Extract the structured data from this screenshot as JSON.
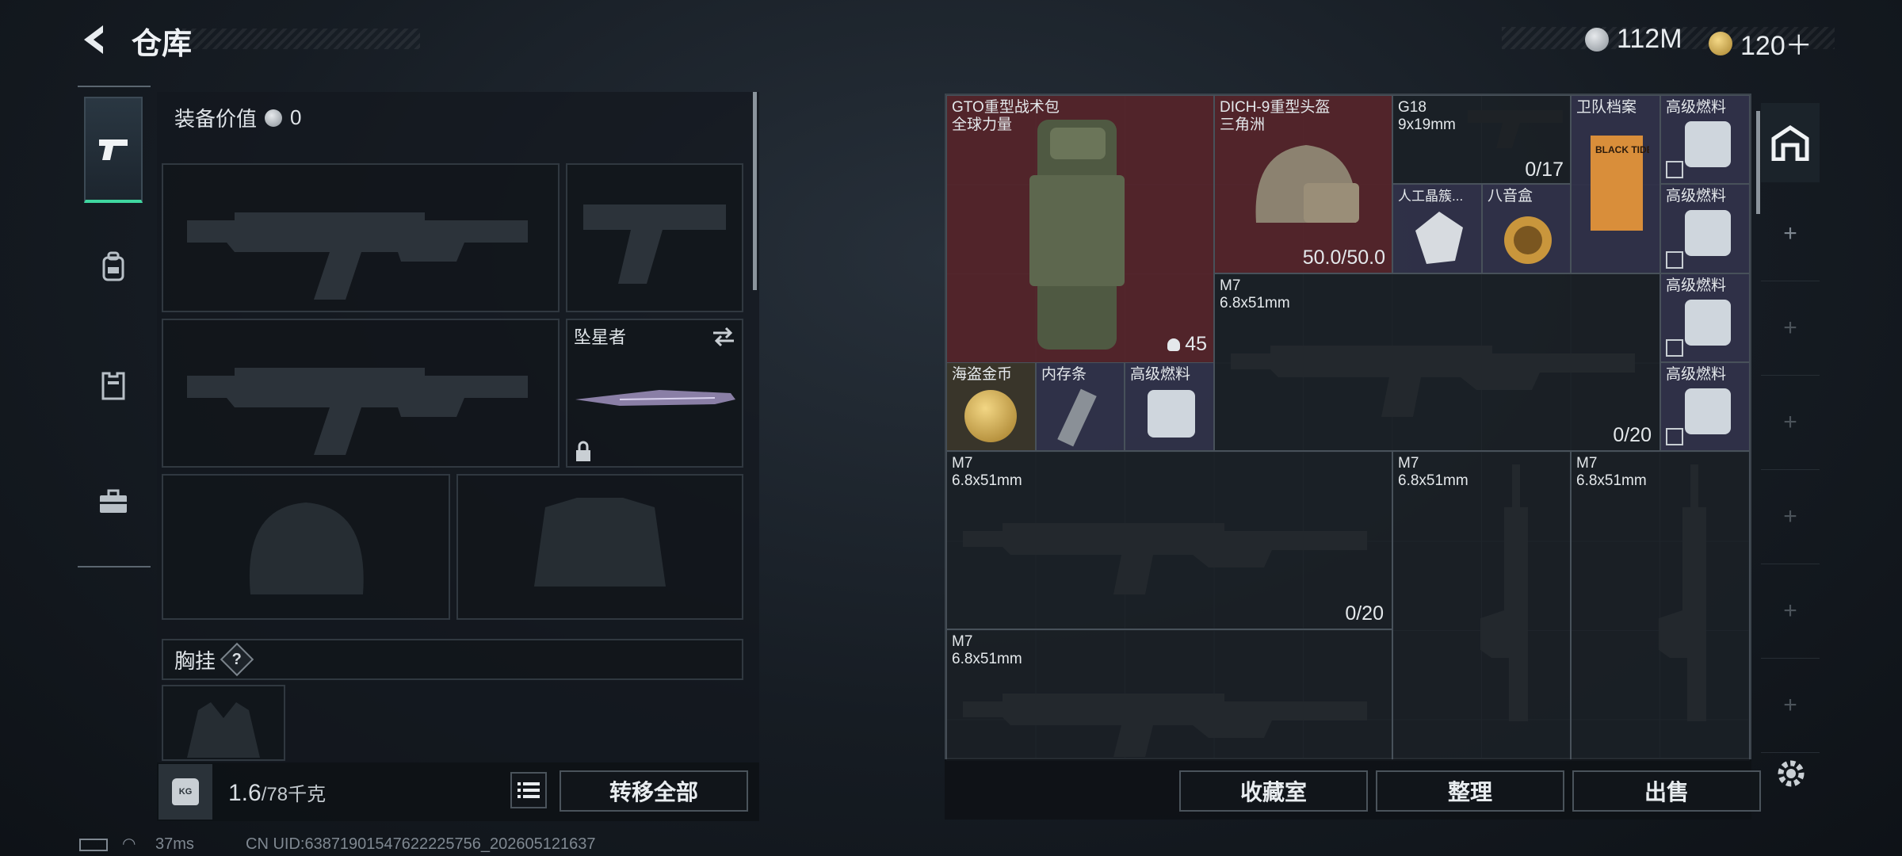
{
  "header": {
    "title": "仓库",
    "currency_silver": "112M",
    "currency_gold": "120＋"
  },
  "left": {
    "equip_value_label": "装备价值",
    "equip_value": "0",
    "melee_name": "坠星者",
    "chest_rig_label": "胸挂",
    "chest_rig_help": "?",
    "weight_value": "1.6",
    "weight_max": "/78千克",
    "kg_badge": "KG",
    "transfer_all": "转移全部"
  },
  "grid": {
    "backpack_name": "GTO重型战术包",
    "backpack_sub": "全球力量",
    "backpack_count": "45",
    "helmet_name": "DICH-9重型头盔",
    "helmet_sub": "三角洲",
    "helmet_durability": "50.0/50.0",
    "g18_name": "G18",
    "g18_caliber": "9x19mm",
    "g18_ammo": "0/17",
    "dossier_name": "卫队档案",
    "crystal_name": "人工晶簇...",
    "octave_name": "八音盒",
    "fuel_name": "高级燃料",
    "m7_name": "M7",
    "m7_caliber": "6.8x51mm",
    "m7_ammo": "0/20",
    "pirate_coin_name": "海盗金币",
    "ram_name": "内存条",
    "dossier_cover_text": "BLACK TIDE"
  },
  "buttons": {
    "collection": "收藏室",
    "organize": "整理",
    "sell": "出售"
  },
  "status": {
    "ping": "37ms",
    "uid": "CN UID:638719015476222257​56_202605121637"
  }
}
